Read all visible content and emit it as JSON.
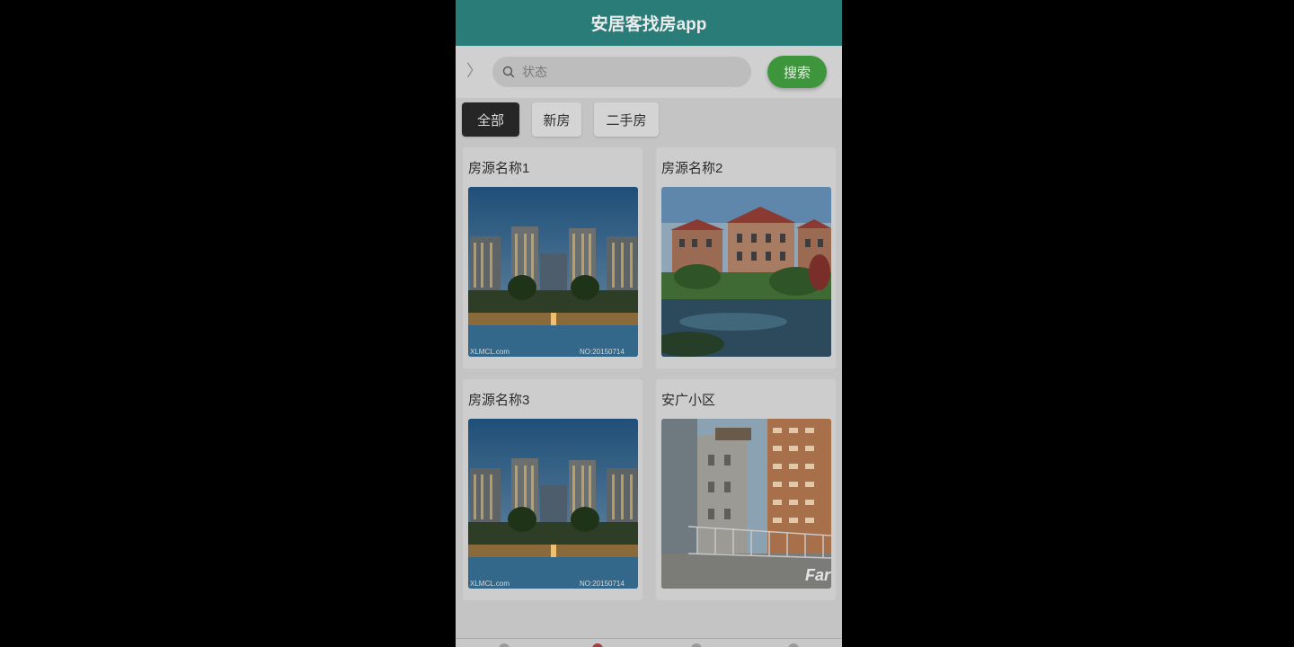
{
  "header": {
    "title": "安居客找房app"
  },
  "search": {
    "placeholder": "状态",
    "button_label": "搜索"
  },
  "tabs": [
    {
      "label": "全部",
      "active": true
    },
    {
      "label": "新房",
      "active": false
    },
    {
      "label": "二手房",
      "active": false
    }
  ],
  "listings": [
    {
      "title": "房源名称1",
      "image": "night-towers-pool"
    },
    {
      "title": "房源名称2",
      "image": "villa-pond"
    },
    {
      "title": "房源名称3",
      "image": "night-towers-pool"
    },
    {
      "title": "安广小区",
      "image": "apartment-buildings"
    }
  ],
  "image_watermarks": {
    "left": "XLMCL.com",
    "right": "NO:20150714",
    "brand": "Far"
  },
  "colors": {
    "header": "#2a7c78",
    "search_button": "#3d963c",
    "active_tab": "#262626"
  }
}
